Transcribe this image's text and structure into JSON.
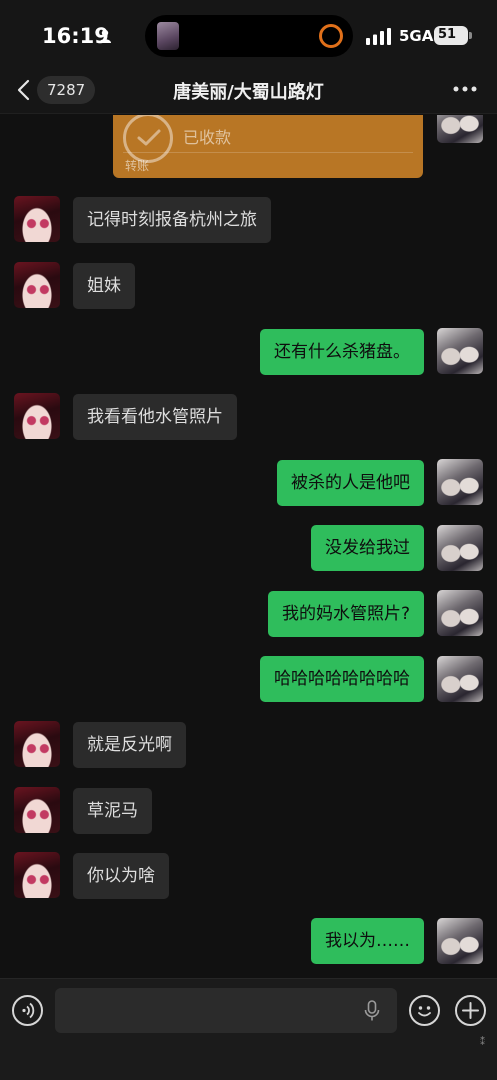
{
  "status_bar": {
    "time": "16:19",
    "network": "5GA",
    "battery": "51",
    "icons": [
      "person-icon",
      "signal-icon",
      "battery-icon"
    ]
  },
  "nav": {
    "unread_count": "7287",
    "title": "唐美丽/大蜀山路灯",
    "icons": [
      "back-icon",
      "more-icon"
    ]
  },
  "transfer": {
    "status": "已收款",
    "label": "转账",
    "color": "#b87625"
  },
  "messages": [
    {
      "side": "left",
      "text": "记得时刻报备杭州之旅"
    },
    {
      "side": "left",
      "text": "姐妹"
    },
    {
      "side": "right",
      "text": "还有什么杀猪盘。"
    },
    {
      "side": "left",
      "text": "我看看他水管照片"
    },
    {
      "side": "right",
      "text": "被杀的人是他吧"
    },
    {
      "side": "right",
      "text": "没发给我过"
    },
    {
      "side": "right",
      "text": "我的妈水管照片?"
    },
    {
      "side": "right",
      "text": "哈哈哈哈哈哈哈哈"
    },
    {
      "side": "left",
      "text": "就是反光啊"
    },
    {
      "side": "left",
      "text": "草泥马"
    },
    {
      "side": "left",
      "text": "你以为啥"
    },
    {
      "side": "right",
      "text": "我以为……"
    }
  ],
  "colors": {
    "background": "#111111",
    "bubble_sent": "#2fbd5c",
    "bubble_received": "#2b2b2b"
  },
  "input_bar": {
    "placeholder": "",
    "icons": [
      "voice-icon",
      "mic-icon",
      "emoji-icon",
      "plus-icon"
    ]
  }
}
